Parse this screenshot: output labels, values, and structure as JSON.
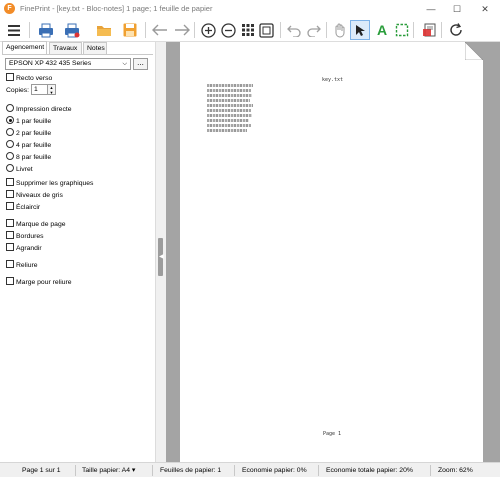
{
  "window": {
    "app_initial": "F",
    "title": "FinePrint - [key.txt - Bloc-notes] 1 page; 1 feuille de papier",
    "minimize": "—",
    "maximize": "☐",
    "close": "✕"
  },
  "toolbar": {
    "icons": [
      "menu-icon",
      "printer-icon",
      "printer-settings-icon",
      "open-folder-icon",
      "save-icon",
      "back-arrow-icon",
      "forward-arrow-icon",
      "zoom-in-icon",
      "zoom-out-icon",
      "grid-icon",
      "fit-page-icon",
      "undo-icon",
      "redo-icon",
      "hand-icon",
      "select-arrow-icon",
      "text-tool-icon",
      "crop-select-icon",
      "stationery-icon",
      "refresh-icon"
    ],
    "accent": "#2a9d3b"
  },
  "tabs": [
    {
      "label": "Agencement",
      "active": true
    },
    {
      "label": "Travaux",
      "active": false
    },
    {
      "label": "Notes",
      "active": false
    }
  ],
  "printer": {
    "selected": "EPSON XP 432 435 Series",
    "more_label": "..."
  },
  "options": {
    "recto_verso": "Recto verso",
    "copies_label": "Copies:",
    "copies_value": "1"
  },
  "layout_options": [
    {
      "label": "Impression directe",
      "checked": false
    },
    {
      "label": "1 par feuille",
      "checked": true
    },
    {
      "label": "2 par feuille",
      "checked": false
    },
    {
      "label": "4 par feuille",
      "checked": false
    },
    {
      "label": "8 par feuille",
      "checked": false
    },
    {
      "label": "Livret",
      "checked": false
    }
  ],
  "checkboxes_a": [
    {
      "label": "Supprimer les graphiques"
    },
    {
      "label": "Niveaux de gris"
    },
    {
      "label": "Éclaircir"
    }
  ],
  "checkboxes_b": [
    {
      "label": "Marque de page"
    },
    {
      "label": "Bordures"
    },
    {
      "label": "Agrandir"
    }
  ],
  "checkboxes_c": [
    {
      "label": "Reliure"
    },
    {
      "label": "Marge pour reliure"
    }
  ],
  "preview": {
    "header_text": "key.txt",
    "footer_text": "Page 1"
  },
  "status": {
    "page": "Page 1 sur 1",
    "paper_size": "Taille papier: A4 ▾",
    "sheets": "Feuilles de papier: 1",
    "paper_saving": "Economie papier: 0%",
    "total_saving": "Economie totale papier: 20%",
    "zoom": "Zoom: 62%"
  }
}
